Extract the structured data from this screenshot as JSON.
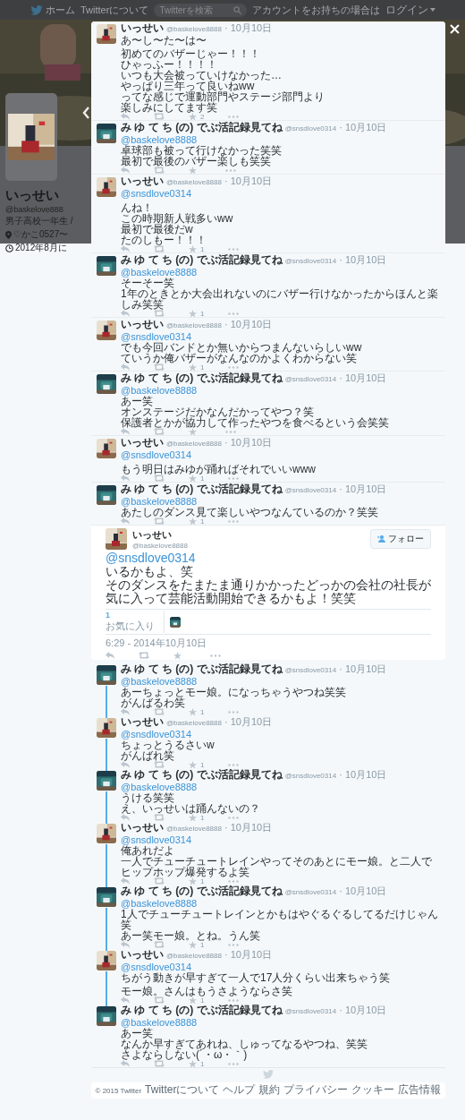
{
  "nav": {
    "home": "ホーム",
    "about": "Twitterについて",
    "search": {
      "placeholder": "Twitterを検索"
    },
    "login_prompt": "アカウントをお持ちの場合は",
    "login": "ログイン"
  },
  "profile": {
    "name": "いっせい",
    "handle": "@baskelove888",
    "bio": "男子高校一年生 /",
    "location": "♡かこ0527〜",
    "joined": "2012年8月に"
  },
  "conversation": [
    {
      "name": "いっせい",
      "handle": "@baskelove8888",
      "date": "· 10月10日",
      "paragraphs": [
        [
          "あ〜し〜た〜は〜"
        ],
        [
          "初めてのバザーじゃー！！！",
          "ひゃっふー！！！！",
          "いつも大会被っていけなかった…",
          "やっぱり三年って良いねww",
          "ってな感じで運動部門やステージ部門より",
          "楽しみにしてます笑"
        ]
      ],
      "favorites": "2"
    },
    {
      "name": "み ゆ て ち (の) でぶ活記録見てね",
      "handle": "@snsdlove0314",
      "date": "· 10月10日",
      "mention": "@baskelove8888",
      "paragraphs": [
        [
          "卓球部も被って行けなかった笑笑",
          "最初で最後のバザー楽しも笑笑"
        ]
      ]
    },
    {
      "name": "いっせい",
      "handle": "@baskelove8888",
      "date": "· 10月10日",
      "mention": "@snsdlove0314",
      "blank_after_mention": true,
      "paragraphs": [
        [
          "んね！",
          "この時期新人戦多いww",
          "最初で最後だw",
          "たのしもー！！！"
        ]
      ],
      "favorites": "1"
    },
    {
      "name": "み ゆ て ち (の) でぶ活記録見てね",
      "handle": "@snsdlove0314",
      "date": "· 10月10日",
      "mention": "@baskelove8888",
      "paragraphs": [
        [
          "そーそー笑",
          "1年のときとか大会出れないのにバザー行けなかったからほんと楽しみ笑笑"
        ]
      ],
      "favorites": "1"
    },
    {
      "name": "いっせい",
      "handle": "@baskelove8888",
      "date": "· 10月10日",
      "mention": "@snsdlove0314",
      "paragraphs": [
        [
          "でも今回バンドとか無いからつまんないらしいww",
          "ていうか俺バザーがなんなのかよくわからない笑"
        ]
      ],
      "favorites": "1"
    },
    {
      "name": "み ゆ て ち (の) でぶ活記録見てね",
      "handle": "@snsdlove0314",
      "date": "· 10月10日",
      "mention": "@baskelove8888",
      "paragraphs": [
        [
          "あー笑",
          "オンステージだかなんだかってやつ？笑",
          "保護者とかが協力して作ったやつを食べるという会笑笑"
        ]
      ]
    },
    {
      "name": "いっせい",
      "handle": "@baskelove8888",
      "date": "· 10月10日",
      "mention": "@snsdlove0314",
      "blank_after_mention": true,
      "paragraphs": [
        [
          "もう明日はみゆが踊ればそれでいいwww"
        ]
      ],
      "favorites": "1"
    },
    {
      "name": "み ゆ て ち (の) でぶ活記録見てね",
      "handle": "@snsdlove0314",
      "date": "· 10月10日",
      "mention": "@baskelove8888",
      "paragraphs": [
        [
          "あたしのダンス見て楽しいやつなんているのか？笑笑"
        ]
      ],
      "favorites": "1"
    }
  ],
  "focused_tweet": {
    "name": "いっせい",
    "handle": "@baskelove8888",
    "follow": "フォロー",
    "mention": "@snsdlove0314",
    "lines": [
      "いるかもよ、笑",
      "そのダンスをたまたま通りかかったどっかの会社の社長が気に入って芸能活動開始できるかもよ！笑笑"
    ],
    "favorites": "1",
    "favorites_label": "お気に入り",
    "time": "6:29 - 2014年10月10日"
  },
  "replies": [
    {
      "name": "み ゆ て ち (の) でぶ活記録見てね",
      "handle": "@snsdlove0314",
      "date": "· 10月10日",
      "mention": "@baskelove8888",
      "paragraphs": [
        [
          "あーちょっとモー娘。になっちゃうやつね笑笑",
          "がんばるわ笑"
        ]
      ],
      "favorites": "1"
    },
    {
      "name": "いっせい",
      "handle": "@baskelove8888",
      "date": "· 10月10日",
      "mention": "@snsdlove0314",
      "paragraphs": [
        [
          "ちょっとうるさいw",
          "がんばれ笑"
        ]
      ],
      "favorites": "1"
    },
    {
      "name": "み ゆ て ち (の) でぶ活記録見てね",
      "handle": "@snsdlove0314",
      "date": "· 10月10日",
      "mention": "@baskelove8888",
      "paragraphs": [
        [
          "うける笑笑",
          "え、いっせいは踊んないの？"
        ]
      ],
      "favorites": "1"
    },
    {
      "name": "いっせい",
      "handle": "@baskelove8888",
      "date": "· 10月10日",
      "mention": "@snsdlove0314",
      "paragraphs": [
        [
          "俺あれだよ",
          "一人でチューチュートレインやってそのあとにモー娘。と二人でヒップホップ爆発するよ笑"
        ]
      ],
      "favorites": "1"
    },
    {
      "name": "み ゆ て ち (の) でぶ活記録見てね",
      "handle": "@snsdlove0314",
      "date": "· 10月10日",
      "mention": "@baskelove8888",
      "paragraphs": [
        [
          "1人でチューチュートレインとかもはやぐるぐるしてるだけじゃん笑",
          "あー笑モー娘。とね。うん笑"
        ]
      ],
      "favorites": "1"
    },
    {
      "name": "いっせい",
      "handle": "@baskelove8888",
      "date": "· 10月10日",
      "mention": "@snsdlove0314",
      "paragraphs": [
        [
          "ちがう動きが早すぎて一人で17人分くらい出来ちゃう笑"
        ],
        [
          "モー娘。さんはもうさようならさ笑"
        ]
      ],
      "favorites": "1"
    },
    {
      "name": "み ゆ て ち (の) でぶ活記録見てね",
      "handle": "@snsdlove0314",
      "date": "· 10月10日",
      "mention": "@baskelove8888",
      "paragraphs": [
        [
          "あー笑",
          "なんか早すぎてあれね、しゅってなるやつね、笑笑",
          "さよならしない(´・ω・｀)"
        ]
      ],
      "favorites": "1"
    }
  ],
  "footer": {
    "links": [
      "© 2015 Twitter",
      "Twitterについて",
      "ヘルプ",
      "規約",
      "プライバシー",
      "クッキー",
      "広告情報"
    ]
  }
}
